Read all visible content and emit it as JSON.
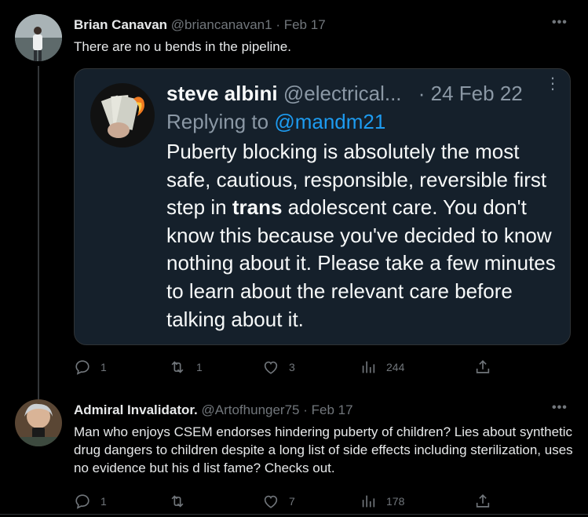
{
  "tweet1": {
    "name": "Brian Canavan",
    "handle": "@briancanavan1",
    "separator": "·",
    "date": "Feb 17",
    "text": "There are no u bends in the pipeline.",
    "more_label": "•••",
    "quote": {
      "name": "steve albini",
      "handle": "@electrical...",
      "separator": "·",
      "date": "24 Feb 22",
      "more_label": "⋮",
      "reply_prefix": "Replying to",
      "reply_mention": "@mandm21",
      "text_before": "Puberty blocking is absolutely the most safe, cautious, responsible, reversible first step in ",
      "text_bold": "trans",
      "text_after": " adolescent care. You don't know this because you've decided to know nothing about it. Please take a few minutes to learn about the relevant care before talking about it."
    },
    "actions": {
      "replies": "1",
      "reposts": "1",
      "likes": "3",
      "views": "244"
    }
  },
  "tweet2": {
    "name": "Admiral Invalidator.",
    "handle": "@Artofhunger75",
    "separator": "·",
    "date": "Feb 17",
    "text": "Man who enjoys CSEM endorses hindering puberty of children? Lies about synthetic drug dangers to children despite a long list of side effects including sterilization, uses no evidence but his d list fame? Checks out.",
    "more_label": "•••",
    "actions": {
      "replies": "1",
      "reposts": "",
      "likes": "7",
      "views": "178"
    }
  },
  "colors": {
    "background": "#000000",
    "text_primary": "#e7e9ea",
    "text_secondary": "#71767b",
    "link": "#1d9bf0",
    "card_bg": "#15202b",
    "border": "#2f3336"
  }
}
